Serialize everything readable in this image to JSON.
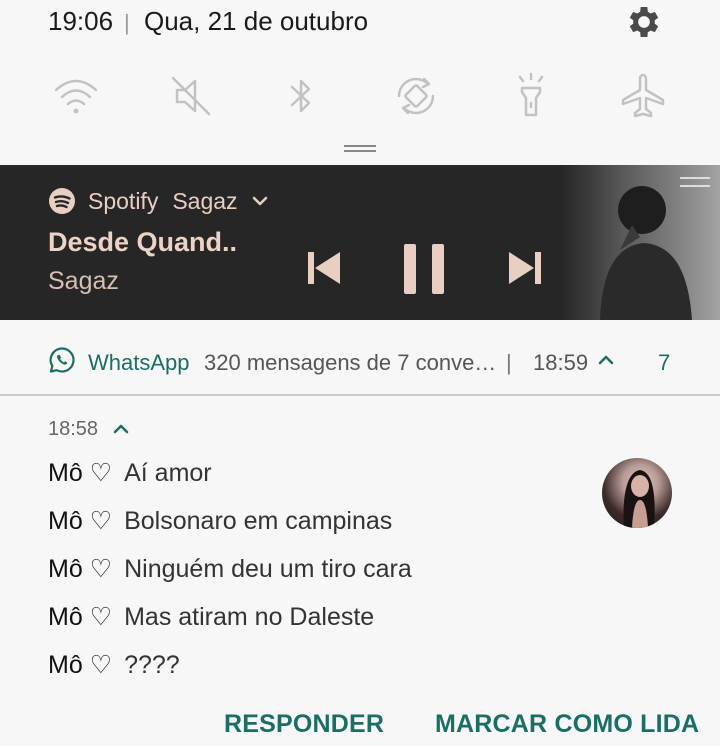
{
  "status_bar": {
    "time": "19:06",
    "separator": "|",
    "date": "Qua, 21 de outubro"
  },
  "quick_toggles": [
    {
      "icon": "wifi-icon"
    },
    {
      "icon": "mute-icon"
    },
    {
      "icon": "bluetooth-icon"
    },
    {
      "icon": "auto-rotate-icon"
    },
    {
      "icon": "flashlight-icon"
    },
    {
      "icon": "airplane-icon"
    }
  ],
  "spotify": {
    "app_name": "Spotify",
    "subtitle": "Sagaz",
    "track_title": "Desde Quand..",
    "artist": "Sagaz",
    "accent_color": "#e8cfc2",
    "background_color": "#262626"
  },
  "whatsapp": {
    "app_name": "WhatsApp",
    "summary": "320 mensagens de 7 conve…",
    "separator": "|",
    "time": "18:59",
    "count": "7",
    "accent_color": "#1b6e63"
  },
  "conversation": {
    "time": "18:58",
    "messages": [
      {
        "sender": "Mô ♡",
        "text": "Aí amor"
      },
      {
        "sender": "Mô ♡",
        "text": "Bolsonaro em campinas"
      },
      {
        "sender": "Mô ♡",
        "text": "Ninguém deu um tiro cara"
      },
      {
        "sender": "Mô ♡",
        "text": "Mas atiram no Daleste"
      },
      {
        "sender": "Mô ♡",
        "text": "????"
      }
    ],
    "actions": {
      "reply": "RESPONDER",
      "mark_read": "MARCAR COMO LIDA"
    }
  }
}
